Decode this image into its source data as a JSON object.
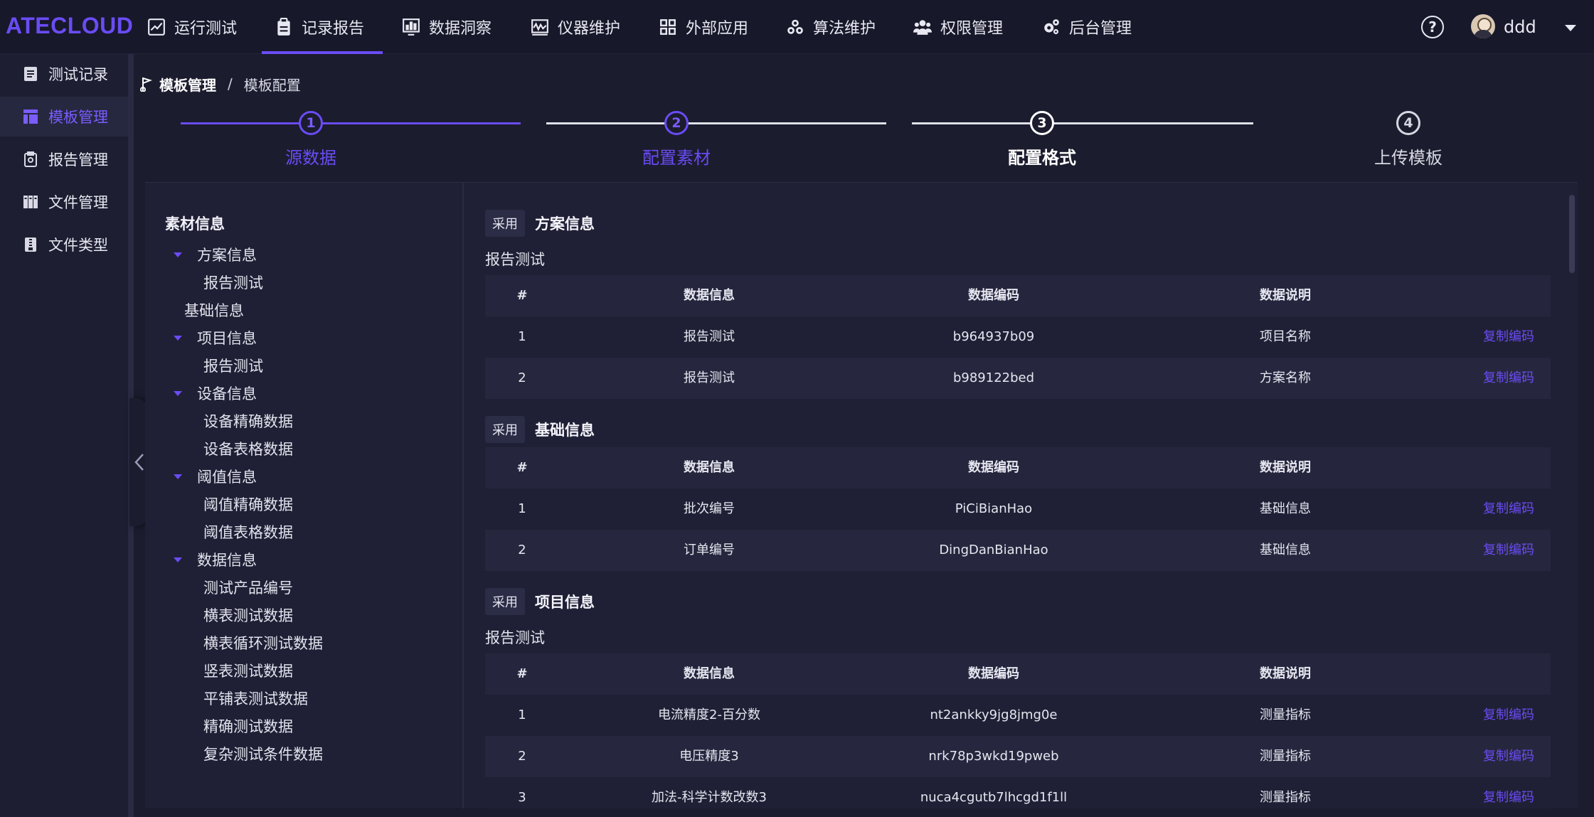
{
  "app": {
    "logo": "ATECLOUD"
  },
  "topnav": {
    "items": [
      {
        "label": "运行测试",
        "icon": "chart-line-icon"
      },
      {
        "label": "记录报告",
        "icon": "clipboard-icon",
        "active": true
      },
      {
        "label": "数据洞察",
        "icon": "chart-bar-icon"
      },
      {
        "label": "仪器维护",
        "icon": "oscilloscope-icon"
      },
      {
        "label": "外部应用",
        "icon": "grid-icon"
      },
      {
        "label": "算法维护",
        "icon": "cubes-icon"
      },
      {
        "label": "权限管理",
        "icon": "users-icon"
      },
      {
        "label": "后台管理",
        "icon": "gears-icon"
      }
    ],
    "help": "?",
    "user": "ddd"
  },
  "sidebar": {
    "items": [
      {
        "label": "测试记录",
        "icon": "list-icon"
      },
      {
        "label": "模板管理",
        "icon": "template-icon",
        "active": true
      },
      {
        "label": "报告管理",
        "icon": "report-icon"
      },
      {
        "label": "文件管理",
        "icon": "files-icon"
      },
      {
        "label": "文件类型",
        "icon": "zip-icon"
      }
    ]
  },
  "breadcrumb": {
    "root": "模板管理",
    "separator": "/",
    "current": "模板配置"
  },
  "steps": [
    {
      "num": "1",
      "label": "源数据",
      "state": "done"
    },
    {
      "num": "2",
      "label": "配置素材",
      "state": "done"
    },
    {
      "num": "3",
      "label": "配置格式",
      "state": "current"
    },
    {
      "num": "4",
      "label": "上传模板",
      "state": "todo"
    }
  ],
  "tree": {
    "title": "素材信息",
    "nodes": [
      {
        "label": "方案信息",
        "level": 1,
        "expanded": true
      },
      {
        "label": "报告测试",
        "level": 2
      },
      {
        "label": "基础信息",
        "level": 0
      },
      {
        "label": "项目信息",
        "level": 1,
        "expanded": true
      },
      {
        "label": "报告测试",
        "level": 2
      },
      {
        "label": "设备信息",
        "level": 1,
        "expanded": true
      },
      {
        "label": "设备精确数据",
        "level": 2
      },
      {
        "label": "设备表格数据",
        "level": 2
      },
      {
        "label": "阈值信息",
        "level": 1,
        "expanded": true
      },
      {
        "label": "阈值精确数据",
        "level": 2
      },
      {
        "label": "阈值表格数据",
        "level": 2
      },
      {
        "label": "数据信息",
        "level": 1,
        "expanded": true
      },
      {
        "label": "测试产品编号",
        "level": 2
      },
      {
        "label": "横表测试数据",
        "level": 2
      },
      {
        "label": "横表循环测试数据",
        "level": 2
      },
      {
        "label": "竖表测试数据",
        "level": 2
      },
      {
        "label": "平铺表测试数据",
        "level": 2
      },
      {
        "label": "精确测试数据",
        "level": 2
      },
      {
        "label": "复杂测试条件数据",
        "level": 2
      }
    ]
  },
  "adopt_label": "采用",
  "columns": [
    "#",
    "数据信息",
    "数据编码",
    "数据说明"
  ],
  "copy_label": "复制编码",
  "sections": [
    {
      "title": "方案信息",
      "subtitle": "报告测试",
      "rows": [
        [
          "1",
          "报告测试",
          "b964937b09",
          "项目名称"
        ],
        [
          "2",
          "报告测试",
          "b989122bed",
          "方案名称"
        ]
      ]
    },
    {
      "title": "基础信息",
      "subtitle": "",
      "rows": [
        [
          "1",
          "批次编号",
          "PiCiBianHao",
          "基础信息"
        ],
        [
          "2",
          "订单编号",
          "DingDanBianHao",
          "基础信息"
        ]
      ]
    },
    {
      "title": "项目信息",
      "subtitle": "报告测试",
      "rows": [
        [
          "1",
          "电流精度2-百分数",
          "nt2ankky9jg8jmg0e",
          "测量指标"
        ],
        [
          "2",
          "电压精度3",
          "nrk78p3wkd19pweb",
          "测量指标"
        ],
        [
          "3",
          "加法-科学计数改数3",
          "nuca4cgutb7lhcgd1f1ll",
          "测量指标"
        ]
      ]
    }
  ]
}
